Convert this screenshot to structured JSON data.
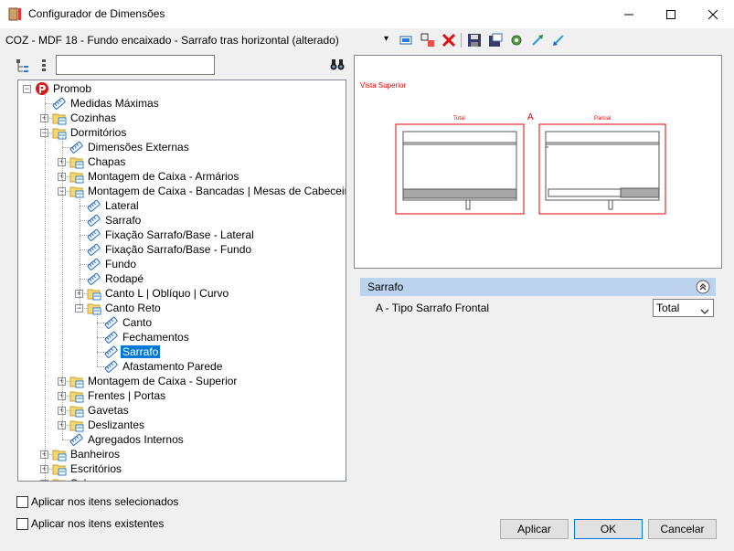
{
  "window": {
    "title": "Configurador de Dimensões",
    "minimize_icon": "minimize-icon",
    "maximize_icon": "maximize-icon",
    "close_icon": "close-icon"
  },
  "toolbar": {
    "config_name": "COZ - MDF 18 - Fundo encaixado - Sarrafo tras horizontal (alterado)",
    "dropdown_arrow": "▾",
    "icons": [
      "config-icon",
      "move-icon",
      "delete-icon",
      "save-icon",
      "save-as-icon",
      "settings-icon",
      "export-icon",
      "import-icon"
    ]
  },
  "tree_toolbar": {
    "search_value": "",
    "search_icon": "binoculars-icon"
  },
  "tree": {
    "items": [
      {
        "label": "Promob",
        "level": 0,
        "expander": "minus",
        "icon": "promob-logo-icon"
      },
      {
        "label": "Medidas Máximas",
        "level": 1,
        "expander": "",
        "icon": "tag-icon"
      },
      {
        "label": "Cozinhas",
        "level": 1,
        "expander": "plus",
        "icon": "folder-icon"
      },
      {
        "label": "Dormitórios",
        "level": 1,
        "expander": "minus",
        "icon": "folder-icon"
      },
      {
        "label": "Dimensões Externas",
        "level": 2,
        "expander": "",
        "icon": "tag-icon"
      },
      {
        "label": "Chapas",
        "level": 2,
        "expander": "plus",
        "icon": "folder-icon"
      },
      {
        "label": "Montagem de Caixa - Armários",
        "level": 2,
        "expander": "plus",
        "icon": "folder-icon"
      },
      {
        "label": "Montagem de Caixa - Bancadas | Mesas de Cabeceira",
        "level": 2,
        "expander": "minus",
        "icon": "folder-icon"
      },
      {
        "label": "Lateral",
        "level": 3,
        "expander": "",
        "icon": "tag-icon"
      },
      {
        "label": "Sarrafo",
        "level": 3,
        "expander": "",
        "icon": "tag-icon"
      },
      {
        "label": "Fixação Sarrafo/Base - Lateral",
        "level": 3,
        "expander": "",
        "icon": "tag-icon"
      },
      {
        "label": "Fixação Sarrafo/Base - Fundo",
        "level": 3,
        "expander": "",
        "icon": "tag-icon"
      },
      {
        "label": "Fundo",
        "level": 3,
        "expander": "",
        "icon": "tag-icon"
      },
      {
        "label": "Rodapé",
        "level": 3,
        "expander": "",
        "icon": "tag-icon"
      },
      {
        "label": "Canto L | Oblíquo | Curvo",
        "level": 3,
        "expander": "plus",
        "icon": "folder-icon"
      },
      {
        "label": "Canto Reto",
        "level": 3,
        "expander": "minus",
        "icon": "folder-icon"
      },
      {
        "label": "Canto",
        "level": 4,
        "expander": "",
        "icon": "tag-icon"
      },
      {
        "label": "Fechamentos",
        "level": 4,
        "expander": "",
        "icon": "tag-icon"
      },
      {
        "label": "Sarrafo",
        "level": 4,
        "expander": "",
        "icon": "tag-icon",
        "selected": true
      },
      {
        "label": "Afastamento Parede",
        "level": 4,
        "expander": "",
        "icon": "tag-icon"
      },
      {
        "label": "Montagem de Caixa - Superior",
        "level": 2,
        "expander": "plus",
        "icon": "folder-icon"
      },
      {
        "label": "Frentes | Portas",
        "level": 2,
        "expander": "plus",
        "icon": "folder-icon"
      },
      {
        "label": "Gavetas",
        "level": 2,
        "expander": "plus",
        "icon": "folder-icon"
      },
      {
        "label": "Deslizantes",
        "level": 2,
        "expander": "plus",
        "icon": "folder-icon"
      },
      {
        "label": "Agregados Internos",
        "level": 2,
        "expander": "",
        "icon": "tag-icon"
      },
      {
        "label": "Banheiros",
        "level": 1,
        "expander": "plus",
        "icon": "folder-icon"
      },
      {
        "label": "Escritórios",
        "level": 1,
        "expander": "plus",
        "icon": "folder-icon"
      },
      {
        "label": "Salas",
        "level": 1,
        "expander": "plus",
        "icon": "folder-icon"
      }
    ]
  },
  "options": {
    "apply_selected": "Aplicar nos itens selecionados",
    "apply_existing": "Aplicar nos itens existentes"
  },
  "preview": {
    "view_label": "Vista Superior",
    "marker": "A",
    "left_label": "Total",
    "right_label": "Parcial",
    "drawing_color": "#e60000"
  },
  "properties": {
    "section_title": "Sarrafo",
    "row_label": "A - Tipo Sarrafo Frontal",
    "row_value": "Total"
  },
  "buttons": {
    "apply": "Aplicar",
    "ok": "OK",
    "cancel": "Cancelar"
  }
}
